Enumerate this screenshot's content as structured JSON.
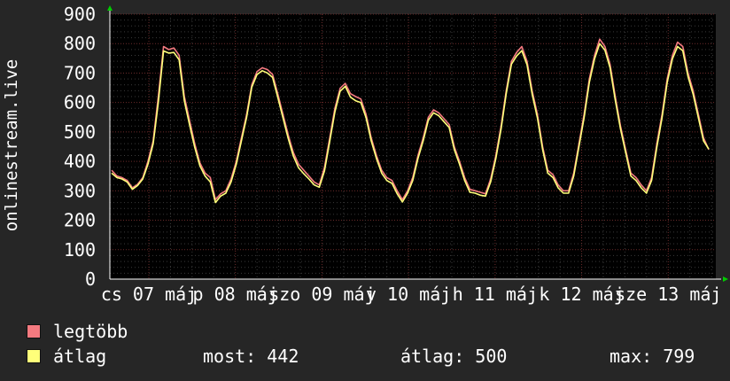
{
  "chart_data": {
    "type": "line",
    "ylabel": "onlinestream.live",
    "ylim": [
      0,
      900
    ],
    "y_ticks": [
      0,
      100,
      200,
      300,
      400,
      500,
      600,
      700,
      800,
      900
    ],
    "x_tick_labels": [
      "cs 07 máj",
      "p 08 máj",
      "szo 09 máj",
      "v 10 máj",
      "h 11 máj",
      "k 12 máj",
      "sze 13 máj"
    ],
    "grid": true,
    "series": [
      {
        "name": "legtöbb",
        "color": "#f47a80",
        "values": [
          370,
          350,
          345,
          335,
          310,
          322,
          345,
          400,
          470,
          620,
          790,
          780,
          785,
          760,
          620,
          540,
          460,
          395,
          360,
          345,
          270,
          290,
          300,
          340,
          400,
          480,
          560,
          660,
          705,
          718,
          712,
          695,
          630,
          560,
          490,
          430,
          390,
          370,
          350,
          330,
          320,
          380,
          480,
          580,
          648,
          665,
          630,
          620,
          612,
          560,
          480,
          420,
          370,
          345,
          335,
          300,
          270,
          300,
          345,
          420,
          480,
          550,
          575,
          565,
          545,
          525,
          450,
          400,
          345,
          305,
          300,
          295,
          290,
          340,
          420,
          520,
          640,
          740,
          770,
          790,
          740,
          640,
          560,
          450,
          370,
          355,
          320,
          300,
          300,
          360,
          460,
          560,
          680,
          760,
          815,
          790,
          730,
          620,
          520,
          440,
          360,
          345,
          320,
          300,
          345,
          460,
          560,
          680,
          760,
          805,
          790,
          700,
          640,
          560,
          480,
          440
        ]
      },
      {
        "name": "átlag",
        "color": "#ffff7a",
        "values": [
          360,
          345,
          340,
          330,
          305,
          318,
          340,
          390,
          460,
          600,
          775,
          768,
          770,
          745,
          605,
          525,
          448,
          385,
          350,
          330,
          260,
          282,
          292,
          330,
          390,
          470,
          550,
          652,
          695,
          708,
          700,
          685,
          618,
          548,
          478,
          418,
          378,
          358,
          340,
          320,
          312,
          368,
          468,
          568,
          638,
          655,
          618,
          606,
          600,
          548,
          470,
          410,
          360,
          335,
          325,
          290,
          262,
          292,
          335,
          410,
          470,
          540,
          565,
          555,
          535,
          515,
          440,
          390,
          335,
          295,
          292,
          285,
          282,
          330,
          410,
          510,
          630,
          730,
          758,
          776,
          728,
          628,
          548,
          440,
          360,
          345,
          310,
          292,
          292,
          350,
          450,
          548,
          668,
          748,
          800,
          778,
          718,
          608,
          510,
          430,
          350,
          335,
          310,
          292,
          335,
          448,
          548,
          668,
          748,
          790,
          776,
          688,
          628,
          548,
          470,
          442
        ]
      }
    ]
  },
  "legend": [
    {
      "label": "legtöbb",
      "color": "#f47a80"
    },
    {
      "label": "átlag",
      "color": "#ffff7a"
    }
  ],
  "stats": {
    "most": "most: 442",
    "atlag": "átlag: 500",
    "max": "max: 799"
  }
}
